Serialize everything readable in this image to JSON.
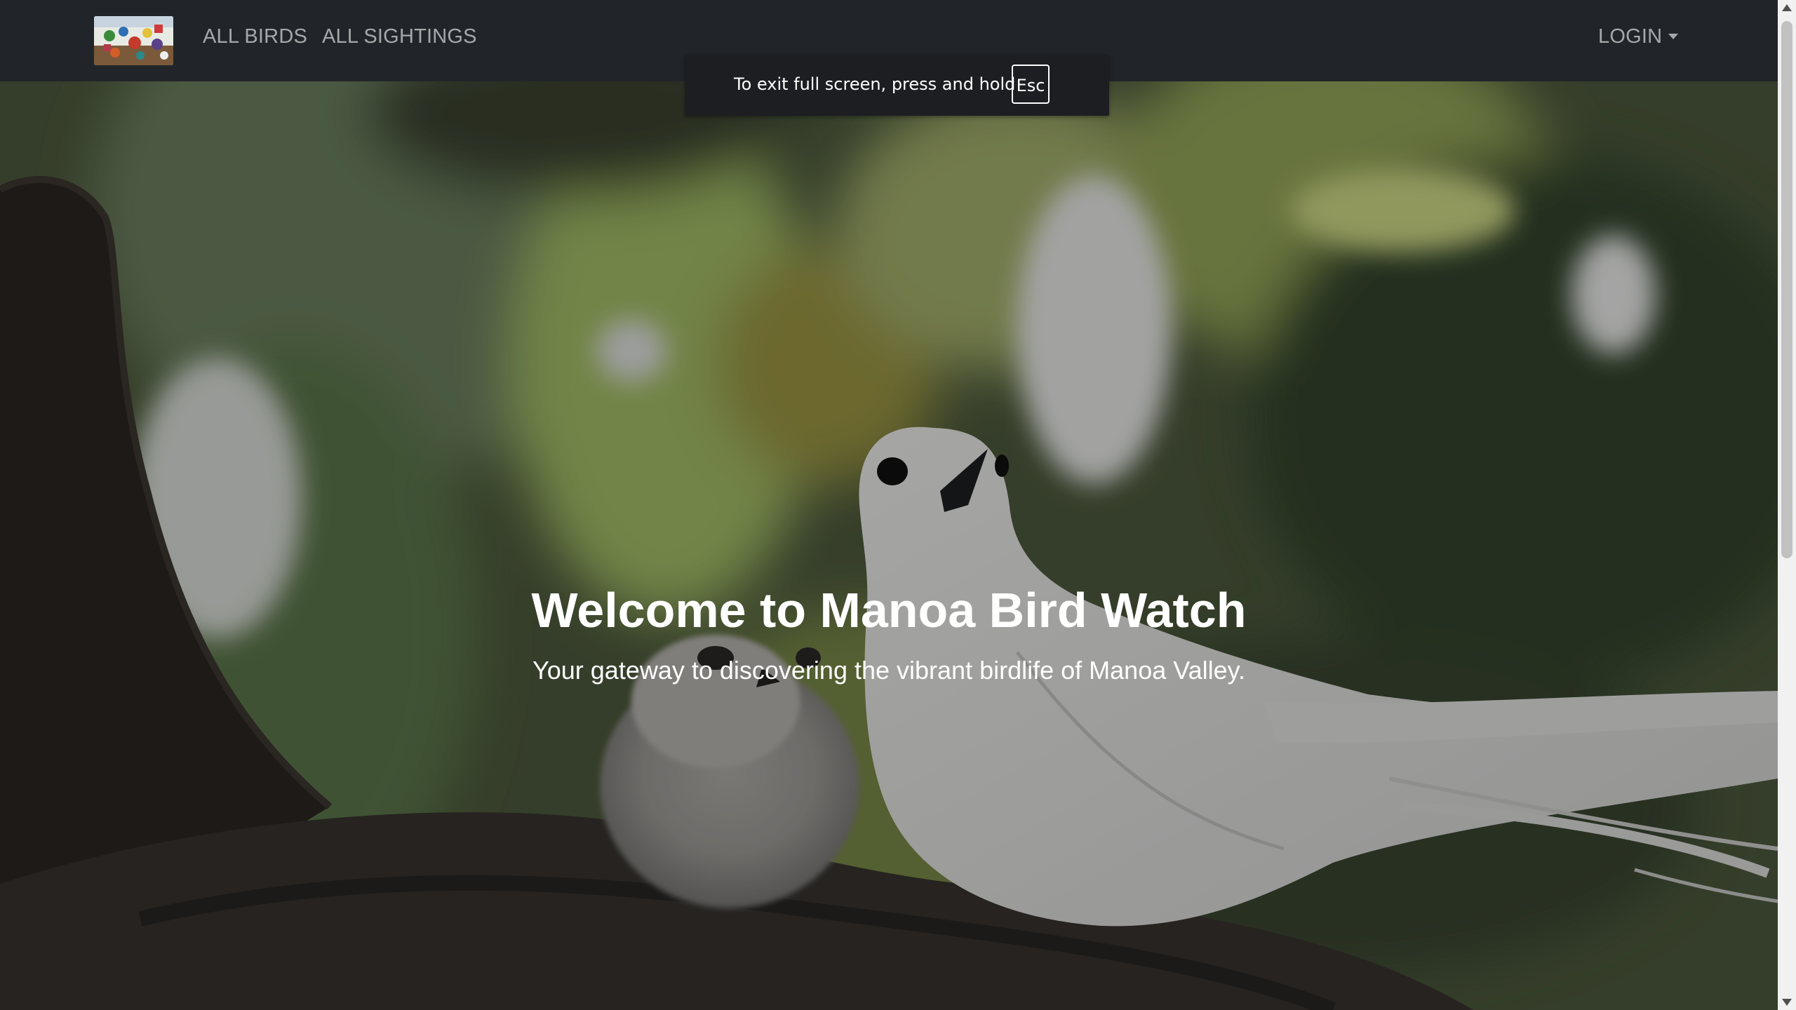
{
  "navbar": {
    "brand_logo": "manoa-bird-watch-logo",
    "links": [
      {
        "label": "ALL BIRDS"
      },
      {
        "label": "ALL SIGHTINGS"
      }
    ],
    "login_label": "LOGIN"
  },
  "fullscreen_toast": {
    "message": "To exit full screen, press and hold",
    "key": "Esc"
  },
  "hero": {
    "title": "Welcome to Manoa Bird Watch",
    "subtitle": "Your gateway to discovering the vibrant birdlife of Manoa Valley.",
    "background_image": "white-tern-adult-and-chick-on-branch"
  },
  "colors": {
    "navbar_bg": "#212529",
    "nav_link": "rgba(255,255,255,0.6)",
    "hero_text": "#ffffff"
  },
  "icons": {
    "login_caret": "caret-down-icon",
    "scroll_up": "scroll-up-icon",
    "scroll_down": "scroll-down-icon"
  }
}
